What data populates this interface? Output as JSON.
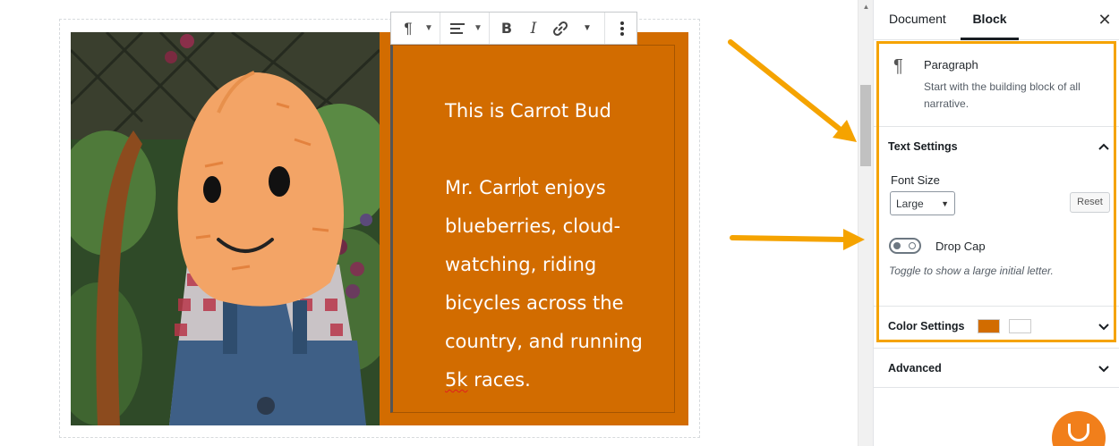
{
  "editor": {
    "text_block": {
      "heading": "This is Carrot Bud",
      "body_before_caret": "Mr. Carr",
      "body_after_caret": "ot enjoys blueberries, cloud-watching, riding bicycles across the country, and running",
      "misspelled_word": "5k",
      "body_end": " races."
    },
    "text_panel_color": "#d26c00"
  },
  "toolbar": {
    "paragraph_icon": "pilcrow-icon",
    "align_icon": "align-left-icon",
    "bold_label": "B",
    "italic_label": "I",
    "link_icon": "link-icon",
    "more_icon": "more-vertical-icon"
  },
  "sidebar": {
    "tabs": {
      "document": "Document",
      "block": "Block"
    },
    "close_icon": "close-icon",
    "block_card": {
      "title": "Paragraph",
      "description": "Start with the building block of all narrative."
    },
    "text_settings": {
      "title": "Text Settings",
      "font_size_label": "Font Size",
      "font_size_value": "Large",
      "reset_label": "Reset",
      "drop_cap_label": "Drop Cap",
      "drop_cap_help": "Toggle to show a large initial letter.",
      "drop_cap_enabled": false
    },
    "color_settings": {
      "title": "Color Settings",
      "swatches": [
        "#d26c00",
        "#ffffff"
      ]
    },
    "advanced": {
      "title": "Advanced"
    }
  },
  "annotations": {
    "highlight_color": "#f5a300"
  },
  "help_button": {
    "color": "#f17f1b"
  }
}
